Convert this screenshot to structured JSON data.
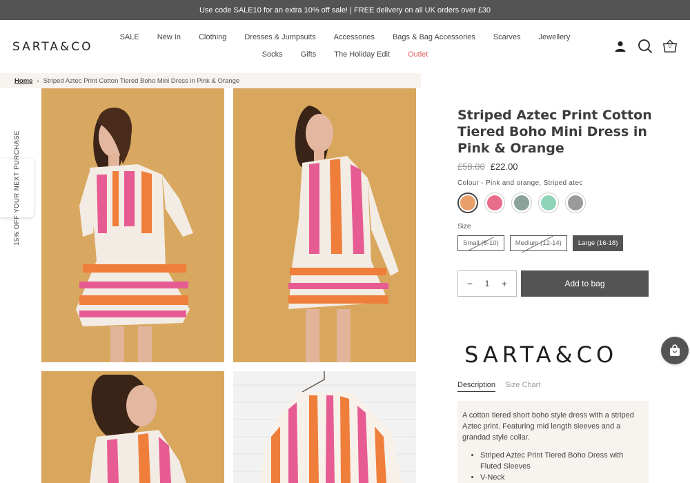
{
  "announcement": "Use code SALE10 for an extra 10% off sale! | FREE delivery on all UK orders over £30",
  "logo": "SARTA&CO",
  "nav": {
    "row1": [
      "SALE",
      "New In",
      "Clothing",
      "Dresses & Jumpsuits",
      "Accessories",
      "Bags & Bag Accessories",
      "Scarves",
      "Jewellery"
    ],
    "row2": [
      "Socks",
      "Gifts",
      "The Holiday Edit",
      "Outlet"
    ]
  },
  "header_icons": {
    "account": "account-icon",
    "search": "search-icon",
    "cart": "basket-icon",
    "cart_count": "0"
  },
  "breadcrumb": {
    "home": "Home",
    "separator": "›",
    "current": "Striped Aztec Print Cotton Tiered Boho Mini Dress in Pink & Orange"
  },
  "side_tab": "15% OFF YOUR NEXT PURCHASE",
  "product": {
    "title": "Striped Aztec Print Cotton Tiered Boho Mini Dress in Pink & Orange",
    "price_old": "£58.00",
    "price_new": "£22.00",
    "colour_label": "Colour - Pink and orange, Striped atec",
    "swatch_colors": [
      "#e9a06a",
      "#e86d8a",
      "#8aa29a",
      "#8fd4b8",
      "#9a9a9a"
    ],
    "size_label": "Size",
    "sizes": [
      {
        "label": "Small (8-10)",
        "state": "soldout"
      },
      {
        "label": "Medium (12-14)",
        "state": "soldout"
      },
      {
        "label": "Large (16-18)",
        "state": "selected"
      }
    ],
    "quantity": "1",
    "add_to_bag": "Add to bag"
  },
  "brand_block": "SARTA&CO",
  "tabs": [
    "Description",
    "Size Chart"
  ],
  "description": {
    "text": "A cotton tiered short boho style dress with a striped Aztec print. Featuring mid length sleeves and a grandad style collar.",
    "bullets": [
      "Striped Aztec Print Tiered Boho Dress with Fluted Sleeves",
      "V-Neck"
    ]
  },
  "colors": {
    "accent_dark": "#545454",
    "outlet_red": "#e05a5a",
    "beige_bg": "#f7f3ef",
    "photo_backdrop": "#d9a860"
  }
}
